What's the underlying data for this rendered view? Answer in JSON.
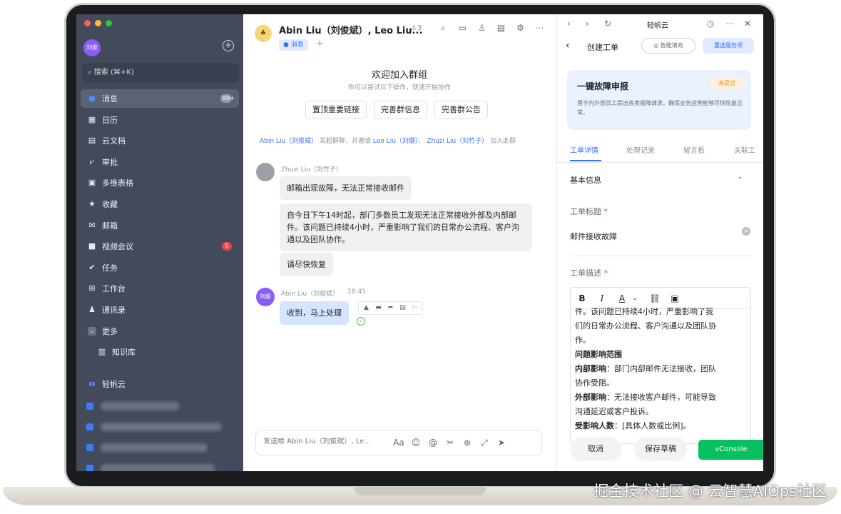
{
  "sidebar": {
    "avatar": "刘俊",
    "search": "搜索 (⌘+K)",
    "items": [
      {
        "label": "消息",
        "icon": "chat-bubble-icon",
        "badge": "99+"
      },
      {
        "label": "日历",
        "icon": "calendar-icon"
      },
      {
        "label": "云文档",
        "icon": "document-icon"
      },
      {
        "label": "审批",
        "icon": "check-flow-icon"
      },
      {
        "label": "多维表格",
        "icon": "table-icon"
      },
      {
        "label": "收藏",
        "icon": "star-icon"
      },
      {
        "label": "邮箱",
        "icon": "mail-icon"
      },
      {
        "label": "视频会议",
        "icon": "video-icon",
        "badge": "5"
      },
      {
        "label": "任务",
        "icon": "checkmark-icon"
      },
      {
        "label": "工作台",
        "icon": "grid-icon"
      },
      {
        "label": "通讯录",
        "icon": "contacts-icon"
      },
      {
        "label": "更多",
        "icon": "chevron-down-icon"
      },
      {
        "label": "知识库",
        "icon": "book-icon"
      },
      {
        "label": "轻帆云",
        "icon": "app-icon"
      }
    ]
  },
  "chat": {
    "title": "Abin Liu（刘俊斌）, Leo Liu...",
    "member_count": "3",
    "tab_label": "消息",
    "welcome_title": "欢迎加入群组",
    "welcome_sub": "你可以尝试以下操作，快速开始协作",
    "welcome_buttons": [
      "置顶重要链接",
      "完善群信息",
      "完善群公告"
    ],
    "sys": {
      "user1": "Abin Liu（刘俊斌）",
      "text1": "发起群聊，并邀请",
      "user2": "Leo Liu（刘璐）",
      "sep": "、",
      "user3": "Zhuzi Liu（刘竹子）",
      "text2": "加入此群"
    },
    "messages": [
      {
        "sender": "Zhuzi Liu（刘竹子）",
        "time": "",
        "lines": [
          "邮箱出现故障，无法正常接收邮件",
          "自今日下午14时起，部门多数员工发现无法正常接收外部及内部邮件。该问题已持续4小时，严重影响了我们的日常办公流程、客户沟通以及团队协作。",
          "请尽快恢复"
        ]
      },
      {
        "sender": "Abin Liu（刘俊斌）",
        "time": "18:45",
        "avatar": "刘俊",
        "lines": [
          "收到，马上处理"
        ]
      }
    ],
    "composer_placeholder": "发送给 Abin Liu（刘俊斌）, Le..."
  },
  "panel": {
    "app_title": "轻帆云",
    "page_title": "创建工单",
    "smart_fill": "智能填充",
    "reselect_service": "重选服务项",
    "hero_title": "一键故障申报",
    "hero_badge": "未提交",
    "hero_desc": "用于内外部员工提出各类报障请求，确保业务运营能够尽快恢复正常。",
    "tabs": [
      "工单详情",
      "处理记录",
      "留言板",
      "关联工"
    ],
    "section": "基本信息",
    "field_title_label": "工单标题",
    "field_title_value": "邮件接收故障",
    "field_desc_label": "工单描述",
    "editor": {
      "l1": "件。该问题已持续4小时，严重影响了我",
      "l2": "们的日常办公流程、客户沟通以及团队协",
      "l3": "作。",
      "h1": "问题影响范围",
      "k1": "内部影响",
      "v1": "：部门内部邮件无法接收，团队",
      "v1b": "协作受阻。",
      "k2": "外部影响",
      "v2": "：无法接收客户邮件，可能导致",
      "v2b": "沟通延迟或客户投诉。",
      "k3": "受影响人数",
      "v3": "：[具体人数或比例]。"
    },
    "cancel": "取消",
    "save_draft": "保存草稿",
    "vconsole": "vConsole"
  },
  "watermark": "掘金技术社区 @ 云智慧AIOps社区",
  "colors": {
    "accent": "#3370ff",
    "sidebar": "#434a5c",
    "badge": "#e5484d",
    "vconsole": "#07c160"
  }
}
